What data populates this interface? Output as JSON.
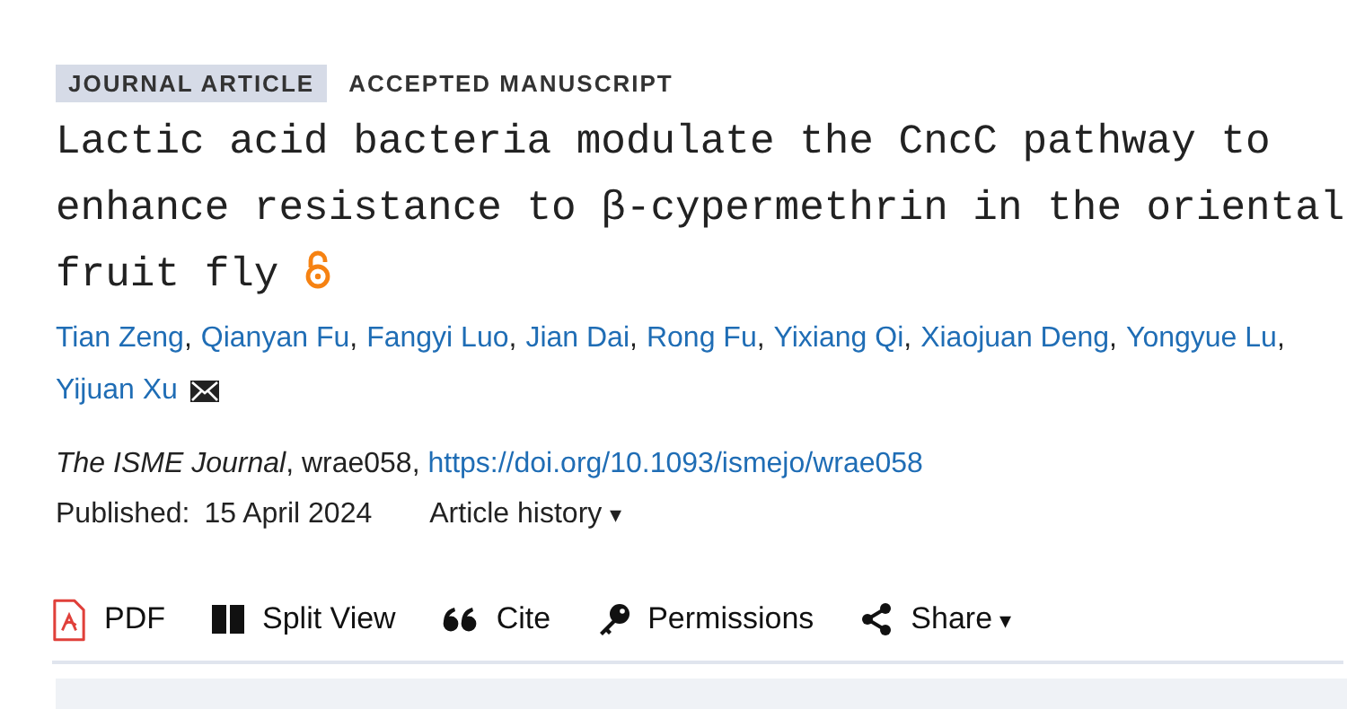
{
  "badges": [
    {
      "label": "JOURNAL ARTICLE",
      "kind": "type"
    },
    {
      "label": "ACCEPTED MANUSCRIPT",
      "kind": "status"
    }
  ],
  "title": "Lactic acid bacteria modulate the CncC pathway to enhance resistance to β-cypermethrin in the oriental fruit fly",
  "open_access": true,
  "authors": [
    {
      "name": "Tian Zeng",
      "separator": ","
    },
    {
      "name": "Qianyan Fu",
      "separator": ","
    },
    {
      "name": "Fangyi Luo",
      "separator": ","
    },
    {
      "name": "Jian Dai",
      "separator": ","
    },
    {
      "name": "Rong Fu",
      "separator": ","
    },
    {
      "name": "Yixiang Qi",
      "separator": ","
    },
    {
      "name": "Xiaojuan Deng",
      "separator": ","
    },
    {
      "name": "Yongyue Lu",
      "separator": ","
    },
    {
      "name": "Yijuan Xu",
      "corresponding": true
    }
  ],
  "citation": {
    "text": "*The ISME Journal*, wrae058, ",
    "doi": "https://doi.org/10.1093/ismejo/wrae058"
  },
  "published": {
    "label": "Published:",
    "date": "15 April 2024"
  },
  "article_history": {
    "label": "Article history",
    "caret": "▾"
  },
  "toolbar": [
    {
      "kind": "pdf",
      "label": "PDF"
    },
    {
      "kind": "split",
      "label": "Split View"
    },
    {
      "kind": "cite",
      "label": "Cite"
    },
    {
      "kind": "permissions",
      "label": "Permissions"
    },
    {
      "kind": "share",
      "label": "Share",
      "caret": "▾"
    }
  ]
}
